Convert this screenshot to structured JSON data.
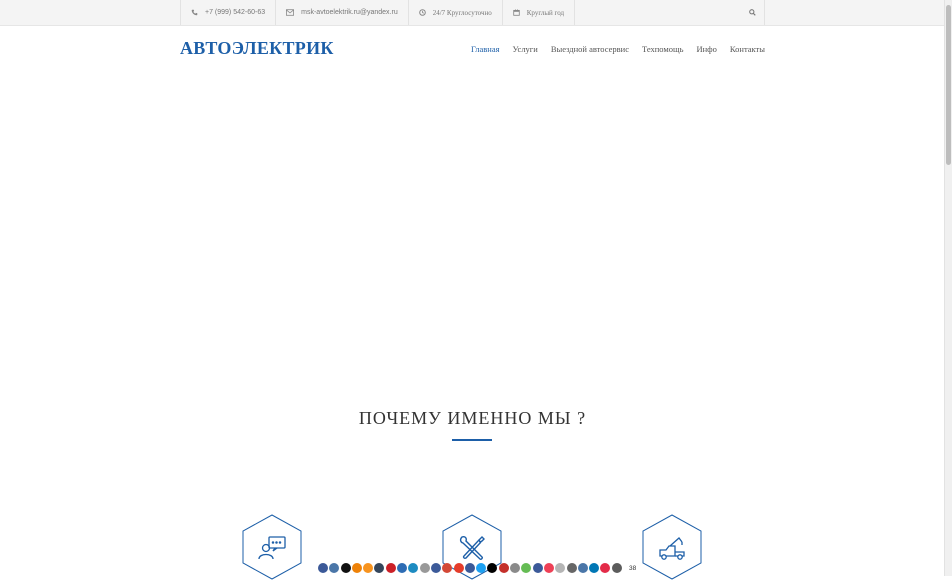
{
  "topbar": {
    "phone": "+7 (999) 542-60-63",
    "email": "msk-avtoelektrik.ru@yandex.ru",
    "hours": "24/7 Круглосуточно",
    "days": "Круглый год"
  },
  "header": {
    "logo": "АВТОЭЛЕКТРИК",
    "nav": [
      "Главная",
      "Услуги",
      "Выездной автосервис",
      "Техпомощь",
      "Инфо",
      "Контакты"
    ]
  },
  "section": {
    "title": "ПОЧЕМУ ИМЕННО МЫ ?"
  },
  "features": [
    {
      "icon": "consultant-icon"
    },
    {
      "icon": "tools-icon"
    },
    {
      "icon": "tow-truck-icon"
    }
  ],
  "share": {
    "count": "38",
    "colors": [
      "#3b5998",
      "#4a76a8",
      "#111111",
      "#ee8208",
      "#f7931e",
      "#35465c",
      "#cb2027",
      "#2d6cb4",
      "#1d8bc1",
      "#999999",
      "#3c5a99",
      "#d34836",
      "#e53c2a",
      "#3b5998",
      "#1da1f2",
      "#000000",
      "#c4302b",
      "#8a8a8a",
      "#65bc54",
      "#3c5a99",
      "#ee4056",
      "#b5b5b5",
      "#666666",
      "#4a76a8",
      "#0077b5",
      "#e32b48",
      "#5c5c5c"
    ]
  },
  "colors": {
    "accent": "#1d5fa8",
    "topbar_bg": "#f4f4f4"
  }
}
